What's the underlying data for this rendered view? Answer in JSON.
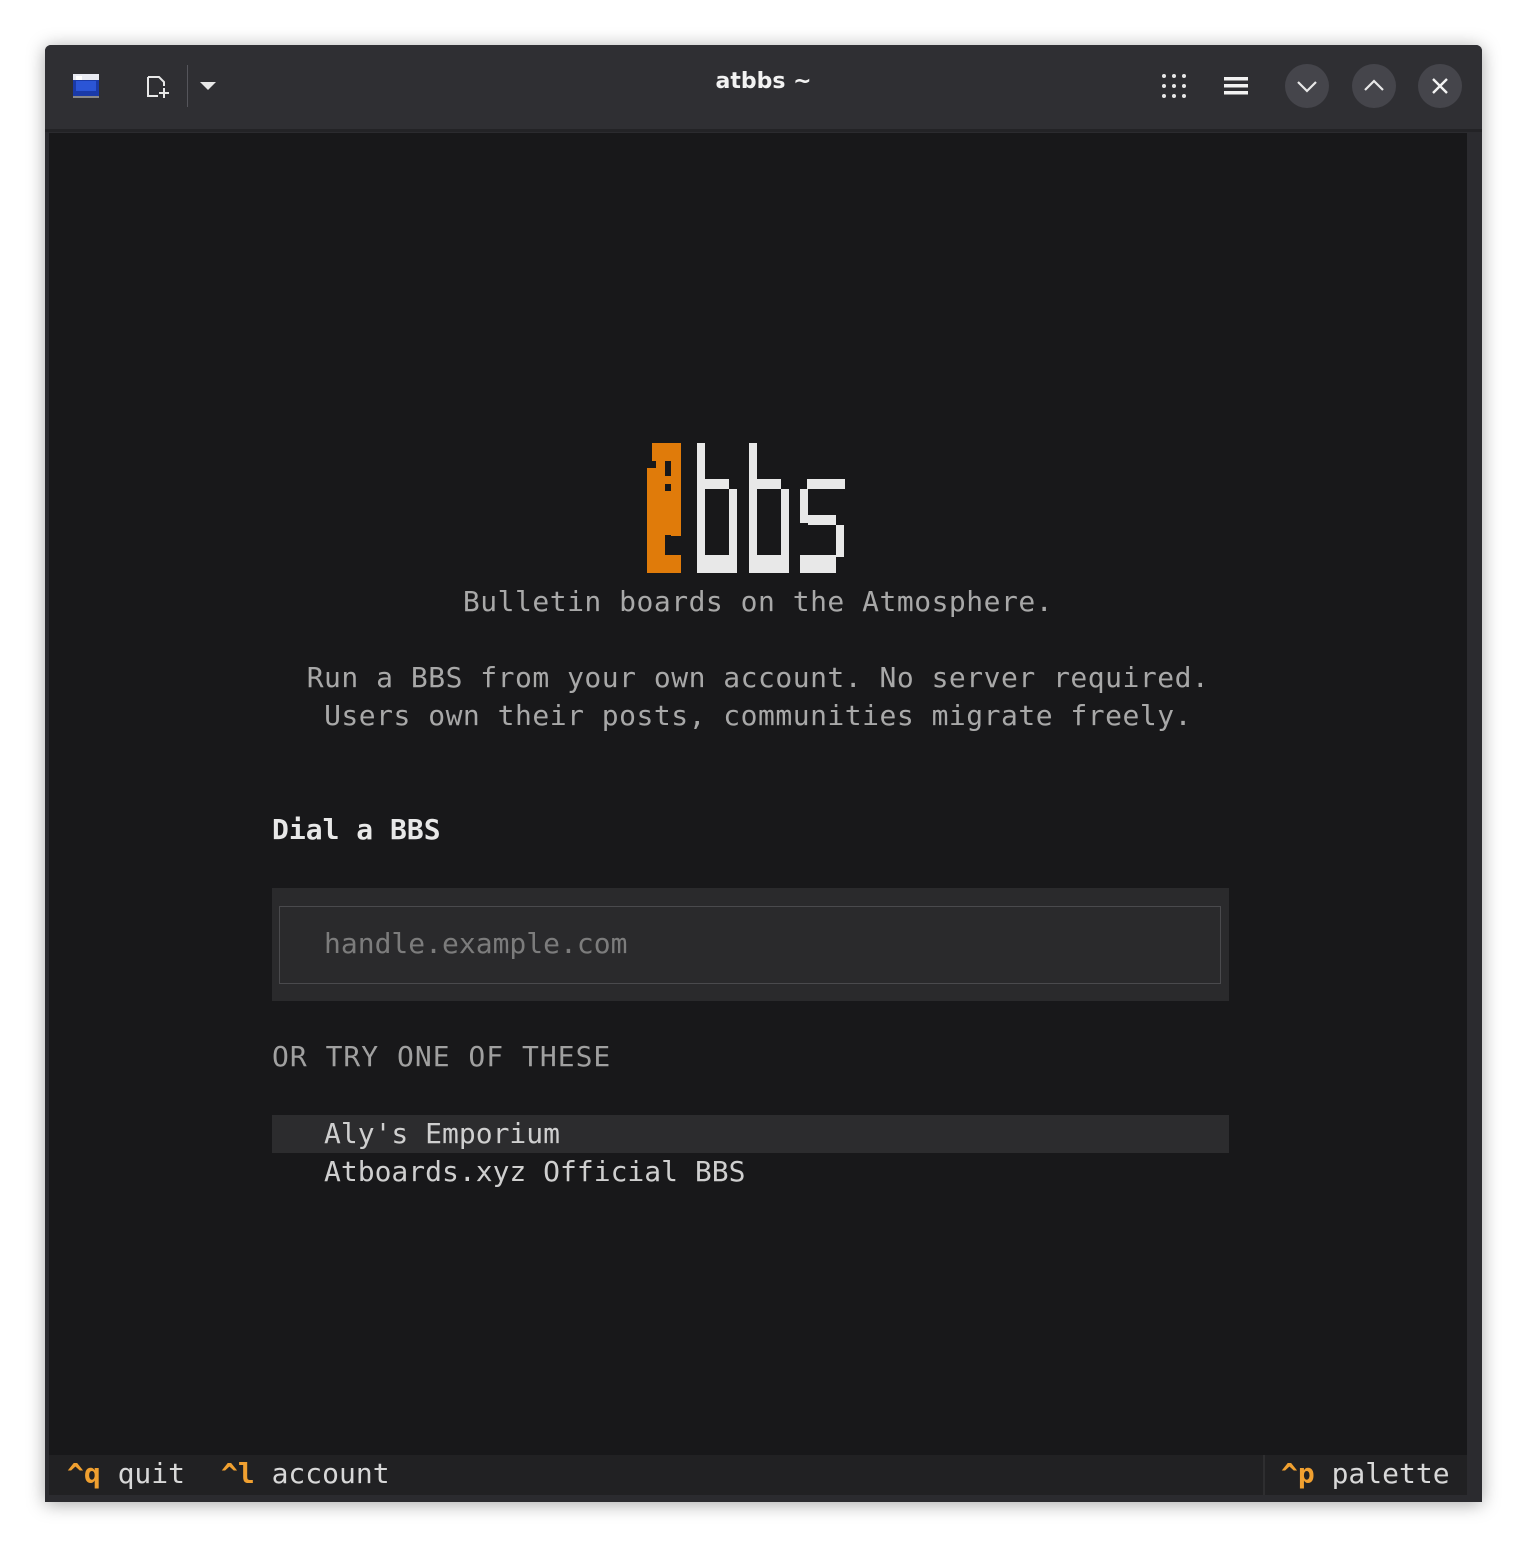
{
  "window": {
    "title": "atbbs ~"
  },
  "toolbar": {
    "icons": [
      "terminal-app-icon",
      "new-tab-icon",
      "dropdown-icon",
      "grid-icon",
      "hamburger-menu-icon",
      "minimize-icon",
      "maximize-icon",
      "close-icon"
    ]
  },
  "logo": {
    "text": "@bbs",
    "accent_color": "#e07b0a",
    "letter_color": "#e8e8e8"
  },
  "tagline": "Bulletin boards on the Atmosphere.",
  "description": {
    "line1": "Run a BBS from your own account. No server required.",
    "line2": "Users own their posts, communities migrate freely."
  },
  "dial": {
    "title": "Dial a BBS",
    "placeholder": "handle.example.com",
    "value": ""
  },
  "suggestions": {
    "label": "OR TRY ONE OF THESE",
    "items": [
      {
        "label": "Aly's Emporium",
        "selected": true
      },
      {
        "label": "Atboards.xyz Official BBS",
        "selected": false
      }
    ]
  },
  "footer": {
    "quit_key": "^q",
    "quit_label": "quit",
    "account_key": "^l",
    "account_label": "account",
    "palette_key": "^p",
    "palette_label": "palette"
  },
  "colors": {
    "accent": "#f0a030",
    "background": "#18181a"
  }
}
